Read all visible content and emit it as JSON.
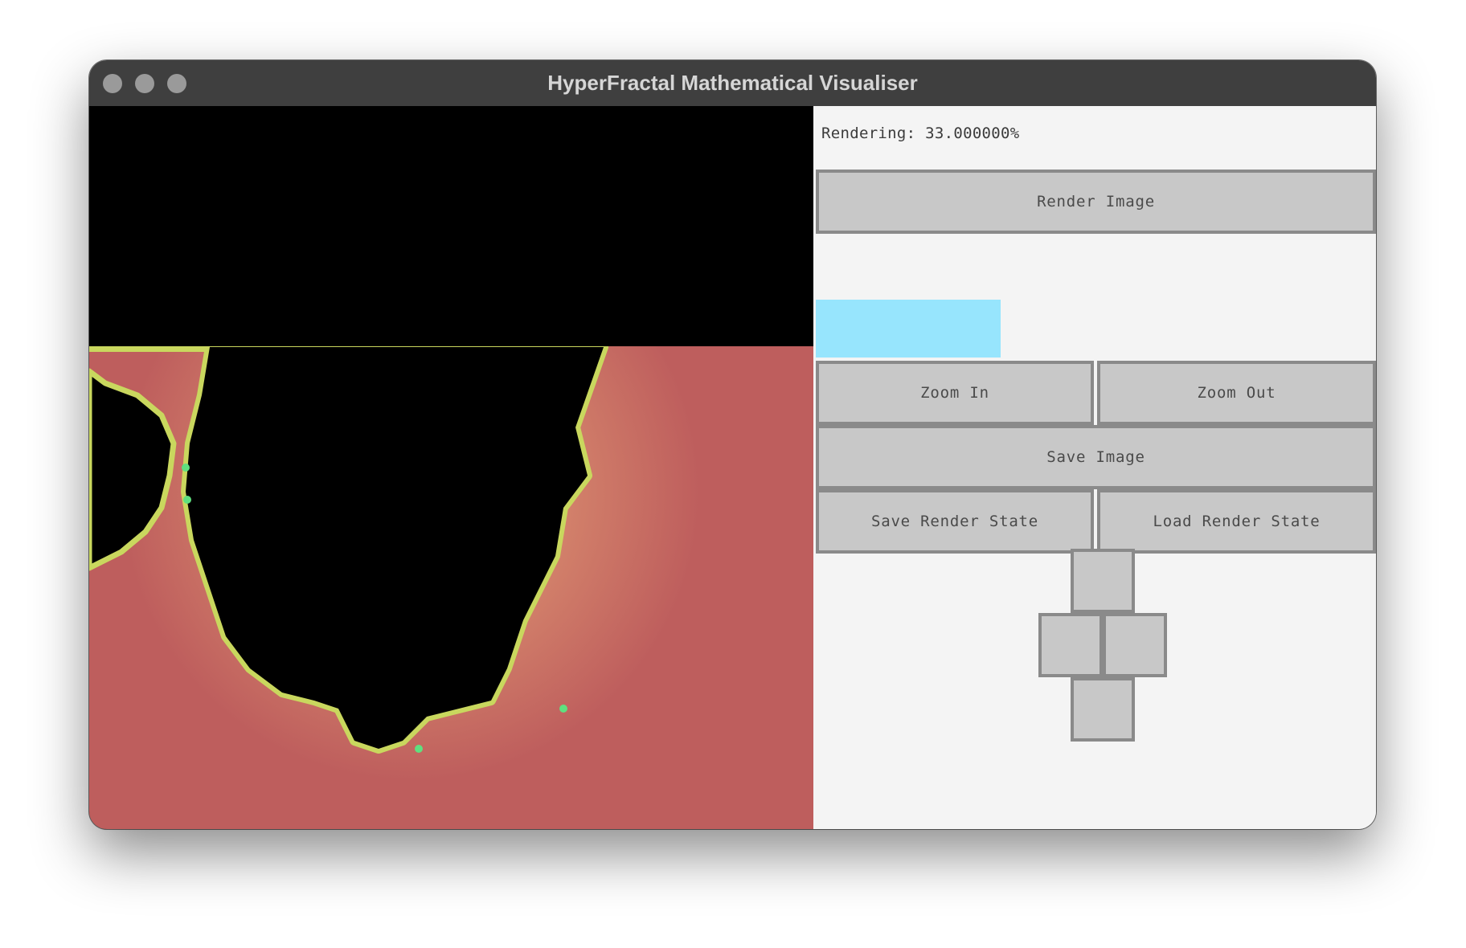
{
  "window": {
    "title": "HyperFractal Mathematical Visualiser",
    "traffic_lights_color": "#9a9a9a"
  },
  "canvas": {
    "rendered_fraction": 0.33,
    "colors": {
      "set_interior": "#000000",
      "exterior": "#be5e5d",
      "boundary": "#c9d75e",
      "boundary_highlight": "#5fe07f"
    }
  },
  "panel": {
    "status_text": "Rendering: 33.000000%",
    "progress_value": 0.33,
    "progress_color": "#97e5fd",
    "buttons": {
      "render": "Render Image",
      "zoom_in": "Zoom In",
      "zoom_out": "Zoom Out",
      "save_image": "Save Image",
      "save_state": "Save Render State",
      "load_state": "Load Render State"
    },
    "dpad": [
      "up",
      "left",
      "right",
      "down"
    ]
  }
}
